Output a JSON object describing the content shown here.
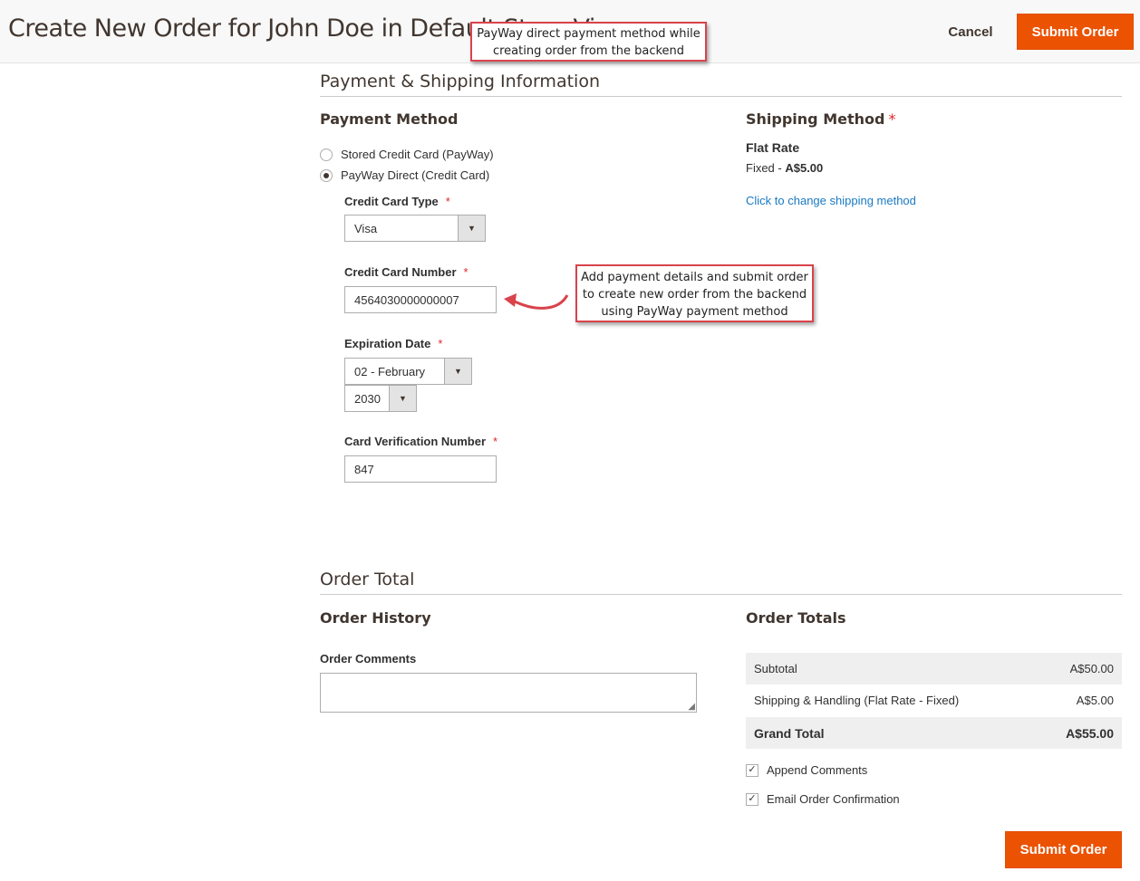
{
  "header": {
    "title": "Create New Order for John Doe in Default Store View",
    "cancel_label": "Cancel",
    "submit_label": "Submit Order"
  },
  "callouts": {
    "top_line1": "PayWay direct payment method while",
    "top_line2": "creating order from the backend",
    "card_line1": "Add payment details and submit order",
    "card_line2": "to create new order from the backend",
    "card_line3": "using PayWay payment method",
    "border_color": "#d9434b"
  },
  "payment_shipping": {
    "section_title": "Payment & Shipping Information",
    "payment_method": {
      "title": "Payment Method",
      "options": [
        {
          "label": "Stored Credit Card (PayWay)",
          "checked": false
        },
        {
          "label": "PayWay Direct (Credit Card)",
          "checked": true
        }
      ],
      "card_type_label": "Credit Card Type",
      "card_type_value": "Visa",
      "card_number_label": "Credit Card Number",
      "card_number_value": "4564030000000007",
      "expiration_label": "Expiration Date",
      "exp_month_value": "02 - February",
      "exp_year_value": "2030",
      "cvn_label": "Card Verification Number",
      "cvn_value": "847",
      "required_mark": "*"
    },
    "shipping_method": {
      "title": "Shipping Method",
      "required_mark": "*",
      "carrier": "Flat Rate",
      "price_prefix": "Fixed - ",
      "price": "A$5.00",
      "change_link": "Click to change shipping method"
    }
  },
  "order_total": {
    "section_title": "Order Total",
    "history_title": "Order History",
    "comments_label": "Order Comments",
    "totals_title": "Order Totals",
    "rows": [
      {
        "label": "Subtotal",
        "value": "A$50.00"
      },
      {
        "label": "Shipping & Handling (Flat Rate - Fixed)",
        "value": "A$5.00"
      },
      {
        "label": "Grand Total",
        "value": "A$55.00"
      }
    ],
    "append_comments": "Append Comments",
    "email_confirmation": "Email Order Confirmation",
    "submit_label": "Submit Order"
  },
  "colors": {
    "accent": "#eb5202",
    "link": "#1979c3",
    "required": "#e22626"
  }
}
